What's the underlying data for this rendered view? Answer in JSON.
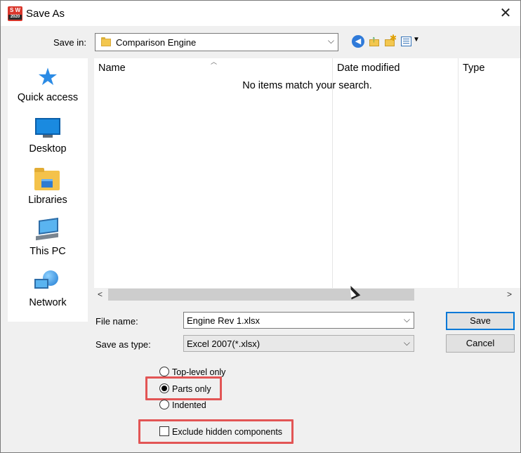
{
  "window": {
    "title": "Save As",
    "app_icon_text": "S W",
    "app_icon_year": "2020"
  },
  "savein": {
    "label": "Save in:",
    "value": "Comparison Engine"
  },
  "places": [
    {
      "label": "Quick access",
      "icon": "star-icon"
    },
    {
      "label": "Desktop",
      "icon": "desktop-icon"
    },
    {
      "label": "Libraries",
      "icon": "libraries-icon"
    },
    {
      "label": "This PC",
      "icon": "computer-icon"
    },
    {
      "label": "Network",
      "icon": "network-icon"
    }
  ],
  "filelist": {
    "columns": [
      "Name",
      "Date modified",
      "Type"
    ],
    "empty_message": "No items match your search."
  },
  "filename": {
    "label": "File name:",
    "value": "Engine Rev 1.xlsx"
  },
  "savetype": {
    "label": "Save as type:",
    "value": "Excel 2007(*.xlsx)"
  },
  "buttons": {
    "save": "Save",
    "cancel": "Cancel"
  },
  "options": {
    "radios": [
      {
        "label": "Top-level only",
        "checked": false
      },
      {
        "label": "Parts only",
        "checked": true
      },
      {
        "label": "Indented",
        "checked": false
      }
    ],
    "exclude_hidden": {
      "label": "Exclude hidden components",
      "checked": false
    }
  },
  "colors": {
    "highlight": "#e25555",
    "accent": "#0078d7"
  }
}
